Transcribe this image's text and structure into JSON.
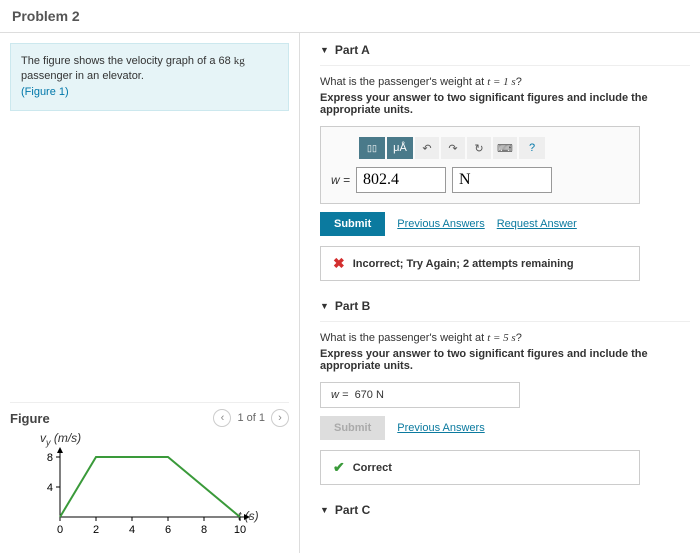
{
  "header": {
    "title": "Problem 2"
  },
  "intro": {
    "text_before": "The figure shows the velocity graph of a 68 ",
    "unit": "kg",
    "text_after": " passenger in an elevator.",
    "figure_link": "(Figure 1)"
  },
  "figure": {
    "title": "Figure",
    "pager_text": "1 of 1",
    "y_axis_label": "v",
    "y_axis_sub": "y",
    "y_axis_unit": "(m/s)",
    "x_axis_label": "t",
    "x_axis_unit": "(s)"
  },
  "chart_data": {
    "type": "line",
    "x": [
      0,
      2,
      6,
      10
    ],
    "y": [
      0,
      8,
      8,
      0
    ],
    "xlabel": "t (s)",
    "ylabel": "v_y (m/s)",
    "xlim": [
      0,
      10
    ],
    "ylim": [
      0,
      8
    ],
    "xticks": [
      0,
      2,
      4,
      6,
      8,
      10
    ],
    "yticks": [
      0,
      4,
      8
    ]
  },
  "partA": {
    "title": "Part A",
    "question_pre": "What is the passenger's weight at ",
    "question_var": "t = 1 s",
    "question_post": "?",
    "instruct": "Express your answer to two significant figures and include the appropriate units.",
    "toolbar": {
      "units_btn": "μÅ",
      "undo": "↶",
      "redo": "↷",
      "reset": "↻",
      "keyboard": "⌨",
      "help": "?"
    },
    "w_label": "w =",
    "value": "802.4",
    "unit": "N",
    "submit": "Submit",
    "prev_answers": "Previous Answers",
    "request_answer": "Request Answer",
    "feedback": "Incorrect; Try Again; 2 attempts remaining"
  },
  "partB": {
    "title": "Part B",
    "question_pre": "What is the passenger's weight at ",
    "question_var": "t = 5 s",
    "question_post": "?",
    "instruct": "Express your answer to two significant figures and include the appropriate units.",
    "w_label": "w =",
    "value_display": "670 N",
    "submit": "Submit",
    "prev_answers": "Previous Answers",
    "feedback": "Correct"
  },
  "partC": {
    "title": "Part C"
  }
}
